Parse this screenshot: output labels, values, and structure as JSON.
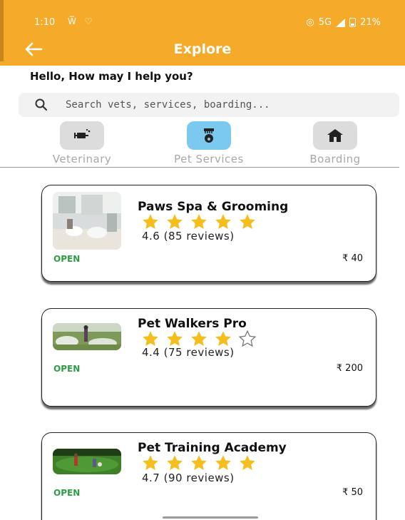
{
  "status_bar": {
    "time": "1:10",
    "left_icons": "W̅ ♡",
    "network": "5G",
    "battery": "21%"
  },
  "header": {
    "title": "Explore",
    "accent_color": "#f6aa2a"
  },
  "greeting": "Hello, How may I help you?",
  "search": {
    "placeholder": "Search vets, services, boarding..."
  },
  "categories": [
    {
      "label": "Veterinary",
      "icon": "syringe-icon",
      "active": false
    },
    {
      "label": "Pet Services",
      "icon": "pet-grooming-icon",
      "active": true
    },
    {
      "label": "Boarding",
      "icon": "house-icon",
      "active": false
    }
  ],
  "listings": [
    {
      "name": "Paws Spa & Grooming",
      "rating_stars": 5,
      "rating_text": "4.6 (85 reviews)",
      "status": "OPEN",
      "price": "₹ 40",
      "image": "spa-salon-photo"
    },
    {
      "name": "Pet Walkers Pro",
      "rating_stars": 4,
      "rating_text": "4.4 (75 reviews)",
      "status": "OPEN",
      "price": "₹ 200",
      "image": "dog-walking-photo"
    },
    {
      "name": "Pet Training Academy",
      "rating_stars": 5,
      "rating_text": "4.7 (90 reviews)",
      "status": "OPEN",
      "price": "₹ 50",
      "image": "training-field-photo"
    }
  ],
  "colors": {
    "star": "#f5be1f",
    "open": "#2e9e45",
    "active_category": "#7cc9f0"
  }
}
